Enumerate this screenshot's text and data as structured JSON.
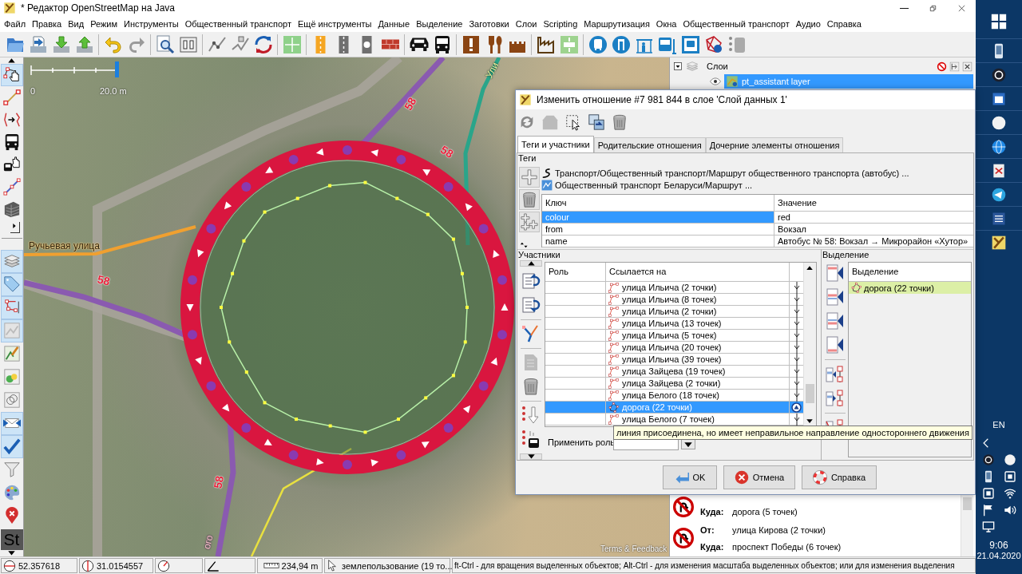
{
  "window": {
    "title": "* Редактор OpenStreetMap на Java"
  },
  "menu": [
    "Файл",
    "Правка",
    "Вид",
    "Режим",
    "Инструменты",
    "Общественный транспорт",
    "Ещё инструменты",
    "Данные",
    "Выделение",
    "Заготовки",
    "Слои",
    "Scripting",
    "Маршрутизация",
    "Окна",
    "Общественный транспорт",
    "Аудио",
    "Справка"
  ],
  "mode_buttons": [
    {
      "kind": "select",
      "selected": true
    },
    {
      "kind": "draw",
      "selected": false
    },
    {
      "kind": "improve",
      "selected": false
    },
    {
      "kind": "bus",
      "selected": false
    },
    {
      "kind": "bus-select",
      "selected": false
    },
    {
      "kind": "line",
      "selected": false
    },
    {
      "kind": "building",
      "selected": false
    }
  ],
  "panel_toggles": [
    {
      "kind": "layers",
      "on": true
    },
    {
      "kind": "tags",
      "on": true
    },
    {
      "kind": "relations",
      "on": true
    },
    {
      "kind": "minimap",
      "on": true
    },
    {
      "kind": "imagery",
      "on": false
    },
    {
      "kind": "photo",
      "on": false
    },
    {
      "kind": "history",
      "on": false
    },
    {
      "kind": "conflict",
      "on": true
    },
    {
      "kind": "validation",
      "on": true
    },
    {
      "kind": "filter",
      "on": false
    },
    {
      "kind": "style",
      "on": false
    },
    {
      "kind": "notes",
      "on": false
    },
    {
      "kind": "text",
      "label": "St",
      "on": false
    }
  ],
  "map": {
    "scale_start": "0",
    "scale_end": "20.0 m",
    "labels": [
      {
        "text": "Ручьевая улица",
        "kind": "street"
      },
      {
        "text": "58",
        "kind": "route"
      },
      {
        "text": "58",
        "kind": "route"
      },
      {
        "text": "58",
        "kind": "route"
      },
      {
        "text": "58",
        "kind": "route"
      },
      {
        "text": "Ули",
        "kind": "street"
      },
      {
        "text": "ого",
        "kind": "street"
      }
    ],
    "attribution": "Terms & Feedback"
  },
  "layers_panel": {
    "title": "Слои",
    "layers": [
      {
        "name": "pt_assistant layer",
        "selected": true
      }
    ]
  },
  "relation_editor": {
    "title": "Изменить отношение #7 981 844 в слое 'Слой данных 1'",
    "tabs": [
      {
        "label": "Теги и участники",
        "selected": true
      },
      {
        "label": "Родительские отношения",
        "selected": false
      },
      {
        "label": "Дочерние элементы отношения",
        "selected": false
      }
    ],
    "tags": {
      "heading": "Теги",
      "presets": [
        {
          "text": "Транспорт/Общественный транспорт/Маршрут общественного транспорта (автобус) ...",
          "kind": "bus"
        },
        {
          "text": "Общественный транспорт Беларуси/Маршрут ...",
          "kind": "pt"
        }
      ],
      "columns": [
        "Ключ",
        "Значение"
      ],
      "rows": [
        {
          "key": "colour",
          "value": "red",
          "selected": true
        },
        {
          "key": "from",
          "value": "Вокзал",
          "selected": false
        },
        {
          "key": "name",
          "value": "Автобус № 58: Вокзал → Микрорайон «Хутор»",
          "selected": false
        }
      ]
    },
    "members": {
      "heading": "Участники",
      "columns": [
        "Роль",
        "Ссылается на"
      ],
      "rows": [
        {
          "member": "улица Ильича (2 точки)",
          "kind": "way",
          "selected": false
        },
        {
          "member": "улица Ильича (8 точек)",
          "kind": "way",
          "selected": false
        },
        {
          "member": "улица Ильича (2 точки)",
          "kind": "way",
          "selected": false
        },
        {
          "member": "улица Ильича (13 точек)",
          "kind": "way",
          "selected": false
        },
        {
          "member": "улица Ильича (5 точек)",
          "kind": "way",
          "selected": false
        },
        {
          "member": "улица Ильича (20 точек)",
          "kind": "way",
          "selected": false
        },
        {
          "member": "улица Ильича (39 точек)",
          "kind": "way",
          "selected": false
        },
        {
          "member": "улица Зайцева (19 точек)",
          "kind": "way",
          "selected": false
        },
        {
          "member": "улица Зайцева (2 точки)",
          "kind": "way",
          "selected": false
        },
        {
          "member": "улица Белого (18 точек)",
          "kind": "way",
          "selected": false
        },
        {
          "member": "дорога (22 точки)",
          "kind": "closed-way",
          "selected": true
        },
        {
          "member": "улица Белого (7 точек)",
          "kind": "way",
          "selected": false
        }
      ],
      "apply_role": "Применить роль",
      "tooltip": "линия присоединена, но имеет неправильное направление одностороннего движения"
    },
    "selection": {
      "heading": "Выделение",
      "column": "Выделение",
      "rows": [
        {
          "member": "дорога (22 точки)"
        }
      ]
    },
    "buttons": [
      {
        "label": "OK",
        "kind": "ok"
      },
      {
        "label": "Отмена",
        "kind": "cancel"
      },
      {
        "label": "Справка",
        "kind": "help"
      }
    ]
  },
  "turn_restrictions": [
    {
      "lines": [
        {
          "role": "Куда:",
          "way": "дорога (5 точек)"
        }
      ]
    },
    {
      "lines": [
        {
          "role": "От:",
          "way": "улица Кирова (2 точки)"
        },
        {
          "role": "Куда:",
          "way": "проспект Победы (6 точек)"
        }
      ]
    }
  ],
  "status_bar": {
    "latitude": "52.357618",
    "longitude": "31.0154557",
    "distance": "234,94 m",
    "hover": "землепользование (19 то...",
    "help": "ft-Ctrl - для вращения выделенных объектов; Alt-Ctrl - для изменения масштаба выделенных объектов; или для изменения выделения"
  },
  "taskbar": {
    "language": "EN",
    "time": "9:06",
    "date": "21.04.2020"
  }
}
